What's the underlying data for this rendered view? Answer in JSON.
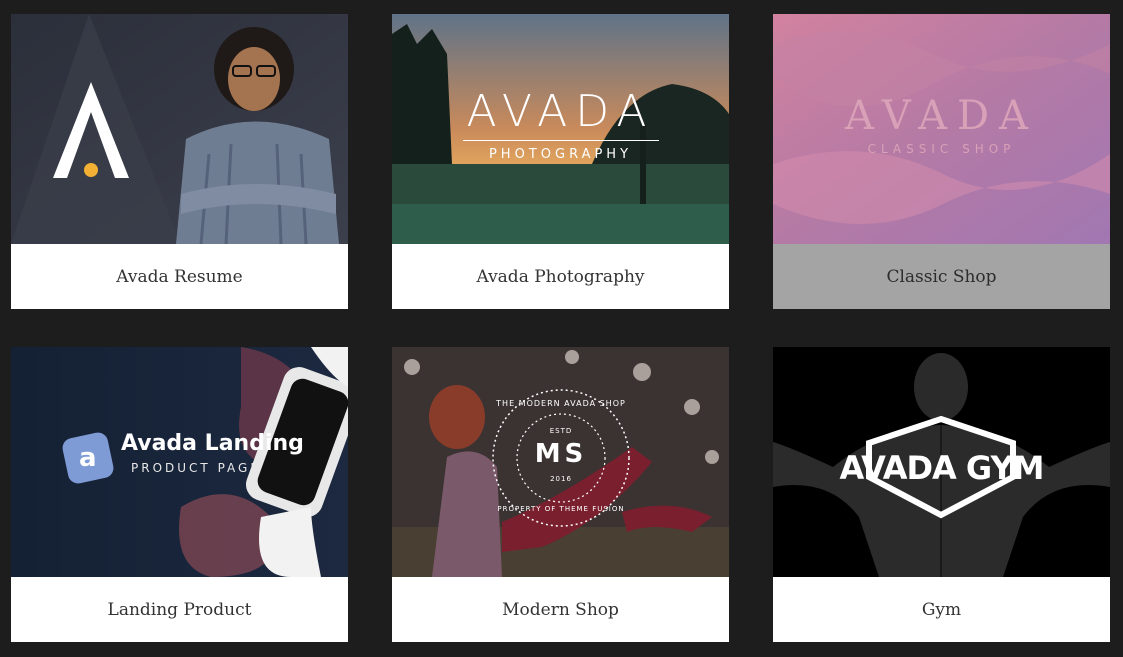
{
  "demos": [
    {
      "label": "Avada Resume",
      "logo": {
        "text": "A"
      }
    },
    {
      "label": "Avada Photography",
      "logo": {
        "title": "AVADA",
        "subtitle": "PHOTOGRAPHY"
      }
    },
    {
      "label": "Classic Shop",
      "logo": {
        "title": "AVADA",
        "subtitle": "CLASSIC SHOP"
      }
    },
    {
      "label": "Landing Product",
      "logo": {
        "icon_letter": "a",
        "title": "Avada Landing",
        "subtitle": "PRODUCT PAGE"
      }
    },
    {
      "label": "Modern Shop",
      "logo": {
        "ring_top": "THE MODERN AVADA SHOP",
        "ring_bottom": "PROPERTY OF THEME FUSION",
        "estd": "ESTD",
        "initials": "MS",
        "year": "2016"
      }
    },
    {
      "label": "Gym",
      "logo": {
        "title": "AVADA GYM"
      }
    }
  ],
  "colors": {
    "page_background": "#1d1d1d",
    "card_label_background": "#ffffff",
    "card_label_dimmed_background": "#a4a4a4",
    "resume_accent": "#f2b134",
    "landing_icon": "#7f9bd6"
  }
}
